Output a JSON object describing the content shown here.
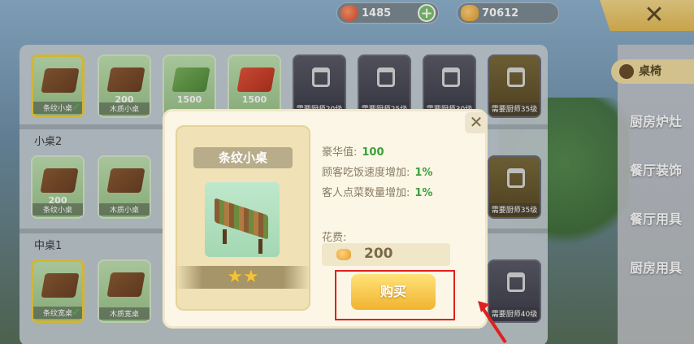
{
  "currencies": {
    "hearts": "1485",
    "coins": "70612"
  },
  "close_symbol": "✕",
  "plus_symbol": "+",
  "sections": [
    {
      "label": "",
      "items": [
        {
          "caption": "条纹小桌",
          "price": "",
          "state": "selected"
        },
        {
          "caption": "木质小桌",
          "price": "200",
          "state": "normal"
        },
        {
          "caption": "",
          "price": "1500",
          "state": "normal"
        },
        {
          "caption": "",
          "price": "1500",
          "state": "normal"
        },
        {
          "caption": "需要厨师20级",
          "price": "",
          "state": "locked"
        },
        {
          "caption": "需要厨师25级",
          "price": "",
          "state": "locked"
        },
        {
          "caption": "需要厨师30级",
          "price": "",
          "state": "locked"
        },
        {
          "caption": "需要厨师35级",
          "price": "",
          "state": "locked"
        }
      ]
    },
    {
      "label": "小桌2",
      "items": [
        {
          "caption": "条纹小桌",
          "price": "200",
          "state": "normal"
        },
        {
          "caption": "木质小桌",
          "price": "",
          "state": "normal"
        },
        {
          "caption": "需要厨师35级",
          "price": "",
          "state": "locked"
        }
      ]
    },
    {
      "label": "中桌1",
      "items": [
        {
          "caption": "条纹宽桌",
          "price": "",
          "state": "selected"
        },
        {
          "caption": "木质宽桌",
          "price": "",
          "state": "normal"
        },
        {
          "caption": "需要厨师40级",
          "price": "",
          "state": "locked"
        }
      ]
    }
  ],
  "tabs": [
    {
      "label": "桌椅",
      "active": true
    },
    {
      "label": "厨房炉灶",
      "active": false
    },
    {
      "label": "餐厅装饰",
      "active": false
    },
    {
      "label": "餐厅用具",
      "active": false
    },
    {
      "label": "厨房用具",
      "active": false
    }
  ],
  "dialog": {
    "item_name": "条纹小桌",
    "stars": 2,
    "attributes": [
      {
        "label": "豪华值:",
        "value": "100"
      },
      {
        "label": "顾客吃饭速度增加:",
        "value": "1%"
      },
      {
        "label": "客人点菜数量增加:",
        "value": "1%"
      }
    ],
    "cost_label": "花费:",
    "cost_value": "200",
    "buy_label": "购买",
    "close_symbol": "✕"
  },
  "colors": {
    "highlight": "#e02020",
    "buy_button": "#f1b32f",
    "attribute_value": "#3aa03a"
  }
}
